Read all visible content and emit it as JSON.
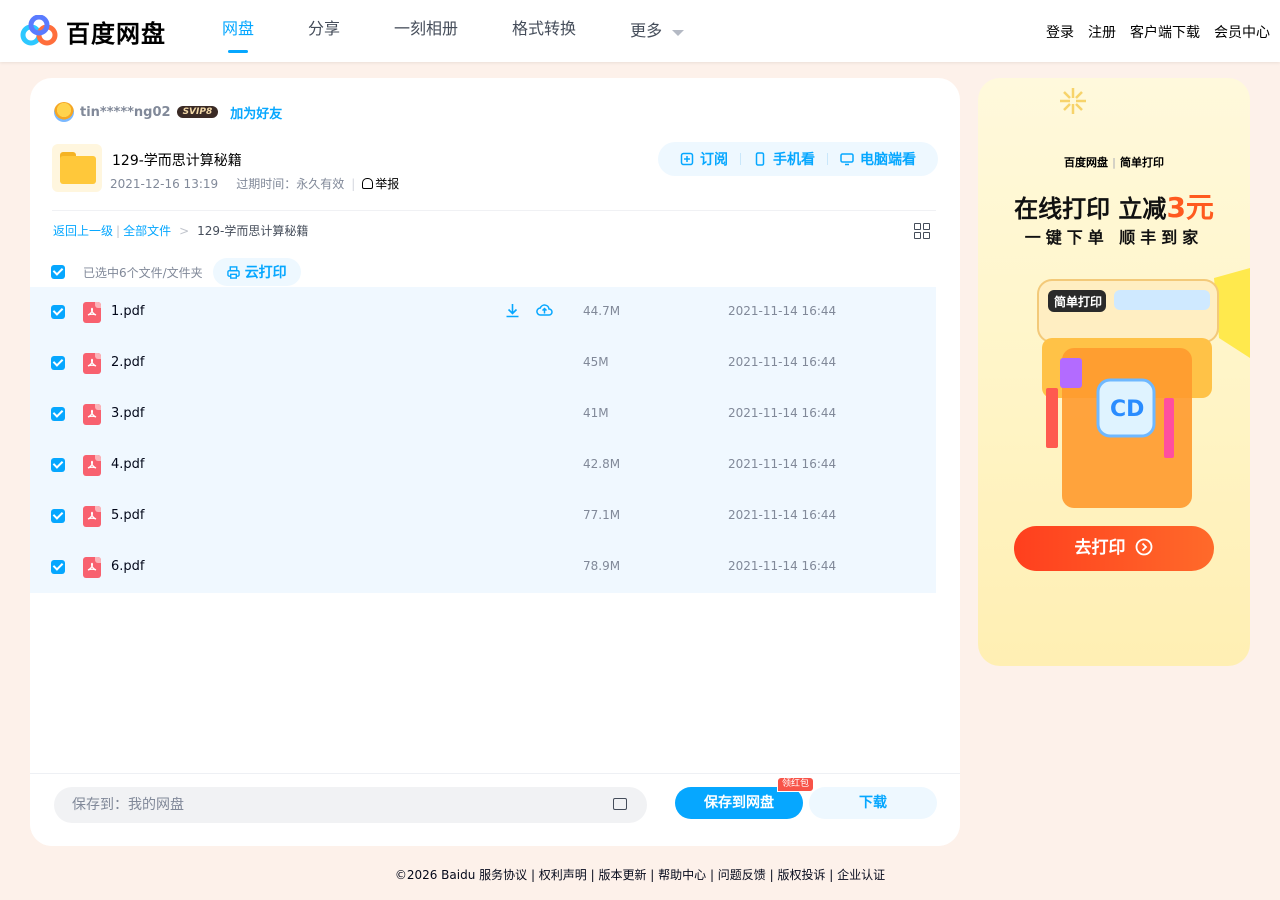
{
  "header": {
    "logo_text": "百度网盘",
    "nav": [
      "网盘",
      "分享",
      "一刻相册",
      "格式转换"
    ],
    "nav_more": "更多",
    "right_links": [
      "登录",
      "注册",
      "客户端下载",
      "会员中心"
    ]
  },
  "share": {
    "sharer_name": "tin*****ng02",
    "vip_badge": "SVIP8",
    "add_friend": "加为好友",
    "title": "129-学而思计算秘籍",
    "date": "2021-12-16 13:19",
    "expiry": "过期时间：永久有效",
    "report": "举报",
    "actions": [
      "订阅",
      "手机看",
      "电脑端看"
    ]
  },
  "breadcrumb": {
    "back": "返回上一级",
    "all_files": "全部文件",
    "current": "129-学而思计算秘籍"
  },
  "selection": {
    "text": "已选中6个文件/文件夹",
    "print_label": "云打印"
  },
  "files": [
    {
      "name": "1.pdf",
      "size": "44.7M",
      "time": "2021-11-14 16:44"
    },
    {
      "name": "2.pdf",
      "size": "45M",
      "time": "2021-11-14 16:44"
    },
    {
      "name": "3.pdf",
      "size": "41M",
      "time": "2021-11-14 16:44"
    },
    {
      "name": "4.pdf",
      "size": "42.8M",
      "time": "2021-11-14 16:44"
    },
    {
      "name": "5.pdf",
      "size": "77.1M",
      "time": "2021-11-14 16:44"
    },
    {
      "name": "6.pdf",
      "size": "78.9M",
      "time": "2021-11-14 16:44"
    }
  ],
  "footer": {
    "save_to": "保存到：我的网盘",
    "save_button": "保存到网盘",
    "red_tag": "领红包",
    "download_button": "下载"
  },
  "ad": {
    "logo_left": "百度网盘",
    "logo_right": "简单打印",
    "headline_prefix": "在线打印 立减",
    "headline_highlight": "3元",
    "subline": "一键下单 顺丰到家",
    "cta": "去打印"
  },
  "copyright": "©2026 Baidu  服务协议 | 权利声明 | 版本更新 | 帮助中心 | 问题反馈 | 版权投诉 | 企业认证",
  "colors": {
    "accent": "#06a7ff",
    "page_bg": "#fdf1ea",
    "pdf_red": "#f8616f",
    "promo_orange": "#ff5a1f"
  }
}
